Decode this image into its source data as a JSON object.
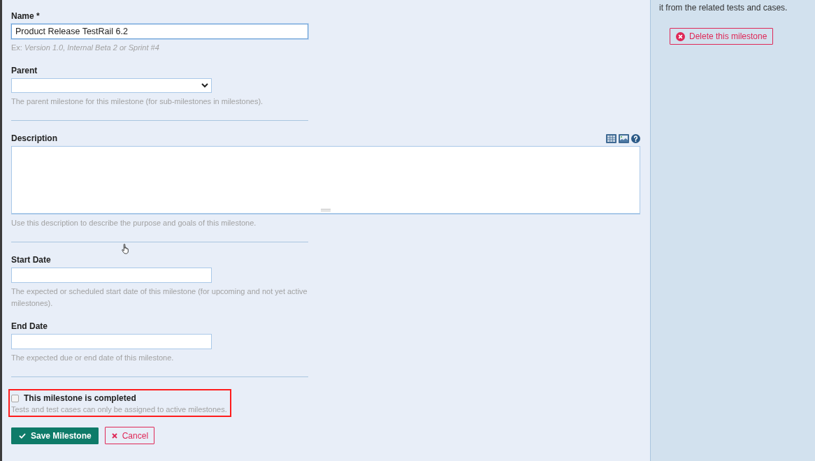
{
  "sections": [
    {
      "fields": [
        {
          "kind": "text",
          "label": "Name *",
          "value": "Product Release TestRail 6.2",
          "focused": true,
          "hint": "Ex: *Version 1.0, Internal Beta 2 or Sprint #4*"
        },
        {
          "kind": "select",
          "label": "Parent",
          "hint": "The parent milestone for this milestone (for sub-milestones in milestones)."
        }
      ]
    },
    {
      "fields": [
        {
          "kind": "textarea",
          "label": "Description",
          "hint": "Use this description to describe the purpose and goals of this milestone."
        }
      ]
    },
    {
      "fields": [
        {
          "kind": "date",
          "label": "Start Date",
          "focused": false,
          "hint": "The expected or scheduled start date of this milestone (for upcoming and not yet active milestones)."
        },
        {
          "kind": "date",
          "label": "End Date",
          "focused": false,
          "hint": "The expected due or end date of this milestone."
        }
      ]
    }
  ],
  "completion": {
    "label": "This milestone is completed",
    "checked": false,
    "highlighted": true,
    "hint": "Tests and test cases can only be assigned to active milestones."
  },
  "buttons": [
    {
      "kind": "save",
      "label": "Save Milestone"
    },
    {
      "kind": "cancel",
      "label": "Cancel"
    }
  ],
  "sidebar": {
    "note": "it from the related tests and cases.",
    "delete_button": {
      "label": "Delete this milestone"
    }
  }
}
